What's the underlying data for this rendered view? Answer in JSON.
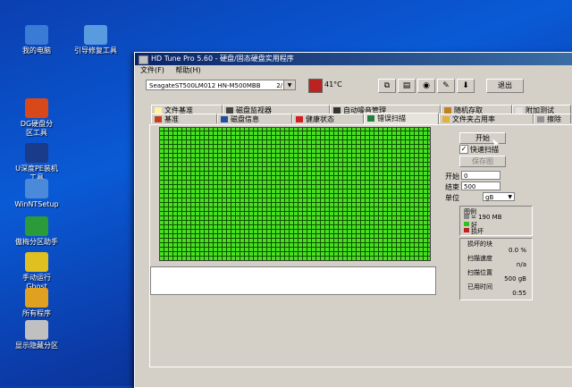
{
  "desktop": {
    "icons": [
      {
        "label": "我的电脑",
        "icon": "computer-icon",
        "color": "#3a7bd5"
      },
      {
        "label": "引导修复工具",
        "icon": "repair-tool-icon",
        "color": "#5a9be0"
      },
      {
        "label": "DG硬盘分\n区工具",
        "icon": "disk-genius-icon",
        "color": "#d9481a"
      },
      {
        "label": "U深度PE装机\n工具",
        "icon": "installer-icon",
        "color": "#1a3a8a"
      },
      {
        "label": "WinNTSetup",
        "icon": "winntsetup-icon",
        "color": "#4a8ad8"
      },
      {
        "label": "傲梅分区助手",
        "icon": "partition-assistant-icon",
        "color": "#2a9a3a"
      },
      {
        "label": "手动运行\nGhost",
        "icon": "ghost-icon",
        "color": "#e0c020"
      },
      {
        "label": "所有程序",
        "icon": "folder-icon",
        "color": "#e0a020"
      },
      {
        "label": "显示隐藏分区",
        "icon": "hidden-partition-icon",
        "color": "#c0c0c0"
      }
    ]
  },
  "window": {
    "title": "HD Tune Pro 5.60 - 硬盘/固态硬盘实用程序",
    "menu": [
      "文件(F)",
      "帮助(H)"
    ],
    "drive": "SeagateST500LM012 HN-M500MBB",
    "drive_size": "2/",
    "temperature": "41°C",
    "exit_label": "退出"
  },
  "tabs_row1": [
    {
      "label": "文件基准"
    },
    {
      "label": "磁盘监视器"
    },
    {
      "label": "自动噪音管理"
    },
    {
      "label": "随机存取"
    },
    {
      "label": "附加测试"
    }
  ],
  "tabs_row2": [
    {
      "label": "基准"
    },
    {
      "label": "磁盘信息"
    },
    {
      "label": "健康状态"
    },
    {
      "label": "错误扫描"
    },
    {
      "label": "文件夹占用率"
    },
    {
      "label": "擦除"
    }
  ],
  "scan": {
    "start_button": "开始",
    "quick_scan_label": "快速扫描",
    "quick_scan_checked": true,
    "save_image_button": "保存图",
    "start_label": "开始",
    "start_value": "0",
    "end_label": "结束",
    "end_value": "500",
    "unit_label": "单位",
    "unit_value": "gB",
    "legend_title": "图例",
    "legend_block": "= 190 MB",
    "legend_good": "好",
    "legend_bad": "损坏",
    "damaged_blocks_label": "损坏的块",
    "damaged_blocks_value": "0.0 %",
    "scan_speed_label": "扫描速度",
    "scan_speed_value": "n/a",
    "scan_position_label": "扫描位置",
    "scan_position_value": "500 gB",
    "elapsed_label": "已用时间",
    "elapsed_value": "0:55"
  }
}
